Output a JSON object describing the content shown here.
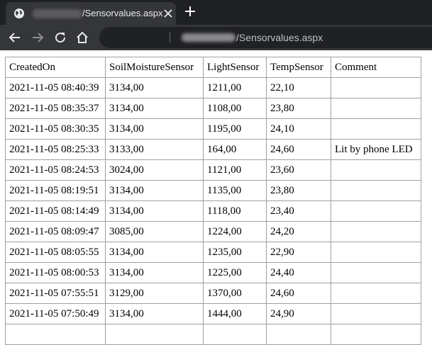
{
  "browser": {
    "tab_title": "/Sensorvalues.aspx",
    "url_path": "/Sensorvalues.aspx"
  },
  "table": {
    "headers": [
      "CreatedOn",
      "SoilMoistureSensor",
      "LightSensor",
      "TempSensor",
      "Comment"
    ],
    "rows": [
      [
        "2021-11-05 08:40:39",
        "3134,00",
        "1211,00",
        "22,10",
        ""
      ],
      [
        "2021-11-05 08:35:37",
        "3134,00",
        "1108,00",
        "23,80",
        ""
      ],
      [
        "2021-11-05 08:30:35",
        "3134,00",
        "1195,00",
        "24,10",
        ""
      ],
      [
        "2021-11-05 08:25:33",
        "3133,00",
        "164,00",
        "24,60",
        "Lit by phone LED"
      ],
      [
        "2021-11-05 08:24:53",
        "3024,00",
        "1121,00",
        "23,60",
        ""
      ],
      [
        "2021-11-05 08:19:51",
        "3134,00",
        "1135,00",
        "23,80",
        ""
      ],
      [
        "2021-11-05 08:14:49",
        "3134,00",
        "1118,00",
        "23,40",
        ""
      ],
      [
        "2021-11-05 08:09:47",
        "3085,00",
        "1224,00",
        "24,20",
        ""
      ],
      [
        "2021-11-05 08:05:55",
        "3134,00",
        "1235,00",
        "22,90",
        ""
      ],
      [
        "2021-11-05 08:00:53",
        "3134,00",
        "1225,00",
        "24,40",
        ""
      ],
      [
        "2021-11-05 07:55:51",
        "3129,00",
        "1370,00",
        "24,60",
        ""
      ],
      [
        "2021-11-05 07:50:49",
        "3134,00",
        "1444,00",
        "24,90",
        ""
      ],
      [
        "",
        "",
        "",
        "",
        ""
      ]
    ]
  }
}
